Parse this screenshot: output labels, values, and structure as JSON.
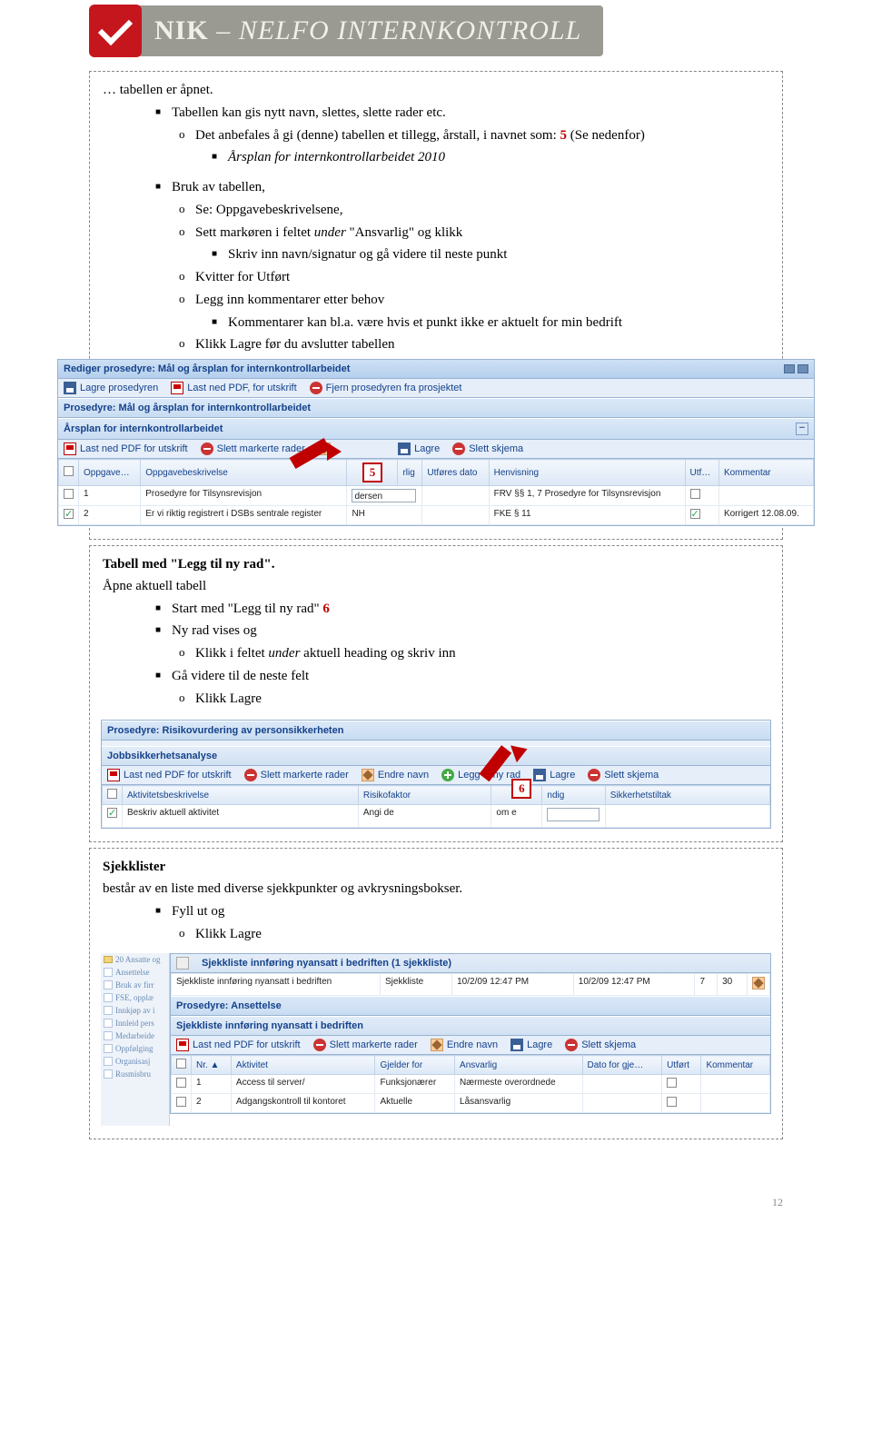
{
  "banner": {
    "brand_bold": "NIK",
    "brand_rest": " – NELFO INTERNKONTROLL"
  },
  "sec1": {
    "line0": "… tabellen er åpnet.",
    "bullet1": "Tabellen kan gis nytt navn, slettes, slette rader etc.",
    "circ1_part1": "Det anbefales å gi (denne) tabellen et tillegg, årstall, i navnet som: ",
    "circ1_red": "5",
    "circ1_part2": " (Se nedenfor)",
    "sub1": "Årsplan for internkontrollarbeidet 2010",
    "bullet2": "Bruk av tabellen,",
    "c2a": "Se: Oppgavebeskrivelsene,",
    "c2b_part1": "Sett markøren i feltet ",
    "c2b_em": "under",
    "c2b_part2": " \"Ansvarlig\" og klikk",
    "c2b_sub": "Skriv inn navn/signatur og gå videre til neste punkt",
    "c2c": "Kvitter for Utført",
    "c2d": "Legg inn kommentarer etter behov",
    "c2d_sub": "Kommentarer kan bl.a. være hvis et punkt ikke er aktuelt for min bedrift",
    "c2e": "Klikk Lagre før du avslutter tabellen"
  },
  "ui1": {
    "win_title": "Rediger prosedyre: Mål og årsplan for internkontrollarbeidet",
    "tb_save_proc": "Lagre prosedyren",
    "tb_last_pdf": "Last ned PDF, for utskrift",
    "tb_fjern": "Fjern prosedyren fra prosjektet",
    "panel_title": "Prosedyre: Mål og årsplan for internkontrollarbeidet",
    "sub_title": "Årsplan for internkontrollarbeidet",
    "row_tb_pdf": "Last ned PDF for utskrift",
    "row_tb_del": "Slett markerte rader",
    "row_tb_edit": "Endre navn",
    "row_tb_save": "Lagre",
    "row_tb_delschema": "Slett skjema",
    "cols": [
      "",
      "Oppgave…",
      "Oppgavebeskrivelse",
      "",
      "rlig",
      "Utføres dato",
      "Henvisning",
      "Utf…",
      "Kommentar"
    ],
    "row1": {
      "num": "1",
      "desc": "Prosedyre for Tilsynsrevisjon",
      "cell4": "dersen",
      "henv": "FRV §§ 1, 7 Prosedyre for Tilsynsrevisjon"
    },
    "row2": {
      "num": "2",
      "desc": "Er vi riktig registrert i DSBs sentrale register",
      "cell4": "NH",
      "henv": "FKE § 11",
      "komm": "Korrigert 12.08.09."
    },
    "callout": "5"
  },
  "sec2": {
    "title": "Tabell med \"Legg til ny rad\".",
    "line1": "Åpne aktuell tabell",
    "b1_part1": "Start med \"Legg til ny rad\" ",
    "b1_red": "6",
    "b2": "Ny rad vises og",
    "b2_c_part1": "Klikk i feltet ",
    "b2_c_em": "under",
    "b2_c_part2": " aktuell heading og skriv inn",
    "b3": "Gå videre til de neste felt",
    "b3_c": "Klikk Lagre"
  },
  "ui2": {
    "panel_title": "Prosedyre: Risikovurdering av personsikkerheten",
    "sub_title": "Jobbsikkerhetsanalyse",
    "tb_pdf": "Last ned PDF for utskrift",
    "tb_del": "Slett markerte rader",
    "tb_edit": "Endre navn",
    "tb_add": "Legg til ny rad",
    "tb_save": "Lagre",
    "tb_delschema": "Slett skjema",
    "cols": [
      "",
      "Aktivitetsbeskrivelse",
      "Risikofaktor",
      "",
      "ndig",
      "Sikkerhetstiltak"
    ],
    "row1": {
      "desc": "Beskriv aktuell aktivitet",
      "risk": "Angi de",
      "mid": "om e"
    },
    "callout": "6"
  },
  "sec3": {
    "title": "Sjekklister",
    "line1": "består av en liste med diverse sjekkpunkter og avkrysningsbokser.",
    "b1": "Fyll ut og",
    "b1_c": "Klikk Lagre"
  },
  "ui3": {
    "side": [
      "20 Ansatte og",
      "Ansettelse",
      "Bruk av firr",
      "FSE, opplæ",
      "Innkjøp av i",
      "Innleid pers",
      "Medarbeide",
      "Oppfølging",
      "Organisasj",
      "Rusmisbru"
    ],
    "list_title": "Sjekkliste innføring nyansatt i bedriften (1 sjekkliste)",
    "list_row": {
      "name": "Sjekkliste innføring nyansatt i bedriften",
      "col2": "Sjekkliste",
      "d1": "10/2/09 12:47 PM",
      "d2": "10/2/09 12:47 PM",
      "n1": "7",
      "n2": "30"
    },
    "panel_title": "Prosedyre: Ansettelse",
    "sub_title": "Sjekkliste innføring nyansatt i bedriften",
    "tb_pdf": "Last ned PDF for utskrift",
    "tb_del": "Slett markerte rader",
    "tb_edit": "Endre navn",
    "tb_save": "Lagre",
    "tb_delschema": "Slett skjema",
    "cols": [
      "",
      "Nr. ▲",
      "Aktivitet",
      "Gjelder for",
      "Ansvarlig",
      "Dato for gje…",
      "Utført",
      "Kommentar"
    ],
    "r1": {
      "nr": "1",
      "akt": "Access til server/",
      "gjeld": "Funksjonærer",
      "ans": "Nærmeste overordnede"
    },
    "r2": {
      "nr": "2",
      "akt": "Adgangskontroll til kontoret",
      "gjeld": "Aktuelle",
      "ans": "Låsansvarlig"
    }
  },
  "pagenum": "12"
}
